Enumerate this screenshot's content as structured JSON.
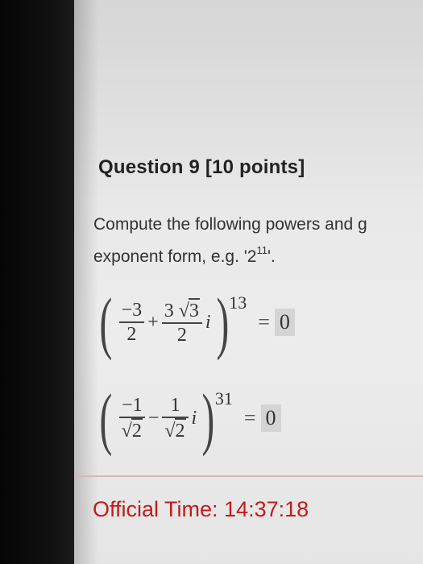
{
  "question": {
    "title": "Question 9 [10 points]"
  },
  "prompt": {
    "line1": "Compute the following powers and g",
    "line2_prefix": "exponent form, e.g. '2",
    "line2_exponent": "11",
    "line2_suffix": "'."
  },
  "expressions": [
    {
      "term1_num": "−3",
      "term1_den": "2",
      "operator": "+",
      "term2_num_coeff": "3",
      "term2_num_radicand": "3",
      "term2_den": "2",
      "imag_unit": "i",
      "exponent": "13",
      "equals": "=",
      "answer": "0"
    },
    {
      "term1_num": "−1",
      "term1_den_radicand": "2",
      "operator": "−",
      "term2_num": "1",
      "term2_den_radicand": "2",
      "imag_unit": "i",
      "exponent": "31",
      "equals": "=",
      "answer": "0"
    }
  ],
  "footer": {
    "official_time": "Official Time: 14:37:18"
  },
  "colors": {
    "time_red": "#c41a1a",
    "answer_box": "#d4d4d4",
    "page_bg": "#e7e7e7"
  }
}
